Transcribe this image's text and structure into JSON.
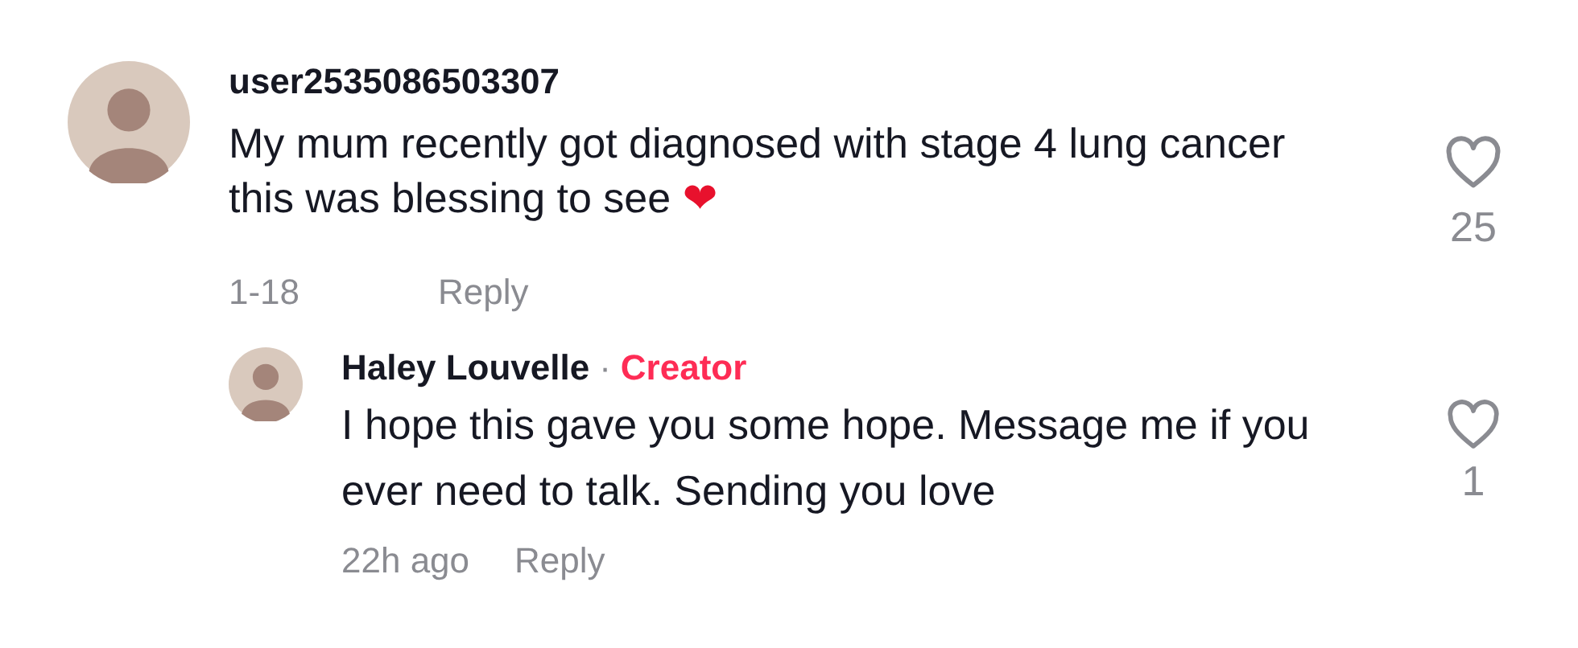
{
  "comments": [
    {
      "username": "user2535086503307",
      "text": "My mum recently got diagnosed with stage 4 lung cancer this was blessing to see",
      "emoji": "❤",
      "date": "1-18",
      "reply_label": "Reply",
      "likes": "25",
      "liked": false,
      "replies": [
        {
          "username": "Haley Louvelle",
          "separator": "·",
          "badge": "Creator",
          "text": "I hope this gave you some hope. Message me if you ever need to talk. Sending you love",
          "date": "22h ago",
          "reply_label": "Reply",
          "likes": "1",
          "liked": false
        }
      ]
    }
  ]
}
